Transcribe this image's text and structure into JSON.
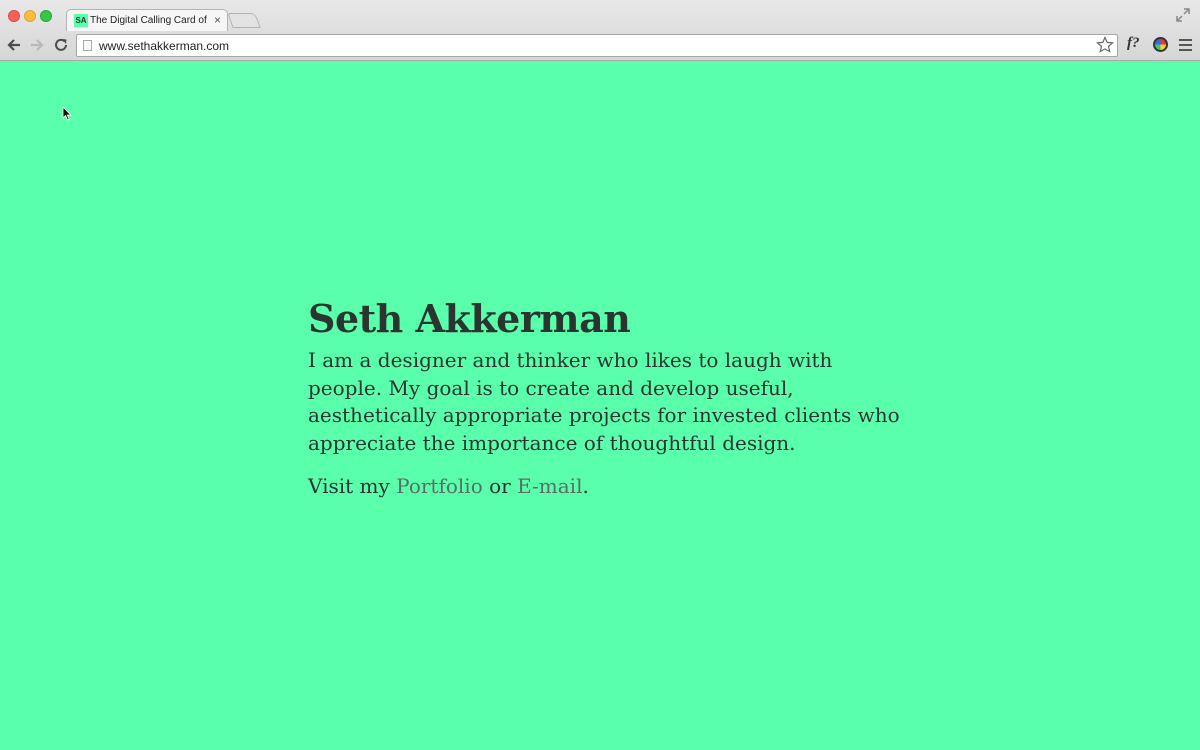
{
  "browser": {
    "tab_favicon": "SA",
    "tab_title": "The Digital Calling Card of",
    "tab_close": "×",
    "url": "www.sethakkerman.com",
    "extension_font_label": "f?",
    "icons": [
      "back-arrow-icon",
      "forward-arrow-icon",
      "reload-icon",
      "page-icon",
      "star-icon",
      "menu-icon"
    ]
  },
  "page": {
    "background_color": "#59ffab",
    "heading": "Seth Akkerman",
    "bio": "I am a designer and thinker who likes to laugh with people.  My goal is to create and develop useful,  aesthetically appropriate projects for invested clients who appreciate the importance of thoughtful design.",
    "visit_prefix": "Visit my ",
    "portfolio_link": "Portfolio",
    "or_text": " or ",
    "email_link": "E-mail",
    "visit_suffix": "."
  }
}
